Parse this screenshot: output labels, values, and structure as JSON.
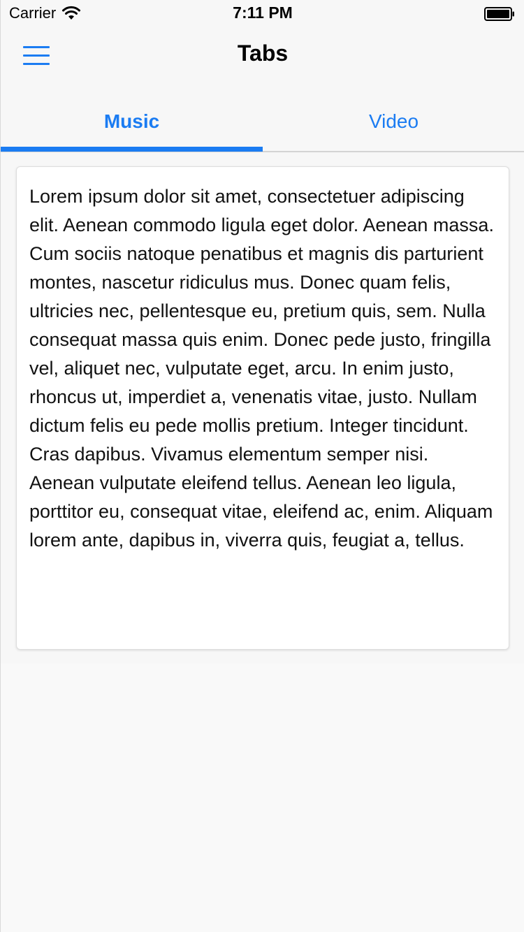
{
  "status_bar": {
    "carrier": "Carrier",
    "time": "7:11 PM"
  },
  "header": {
    "title": "Tabs",
    "menu_icon": "hamburger-menu-icon"
  },
  "tabs": [
    {
      "label": "Music",
      "active": true
    },
    {
      "label": "Video",
      "active": false
    }
  ],
  "card": {
    "text": "Lorem ipsum dolor sit amet, consectetuer adipiscing elit. Aenean commodo ligula eget dolor. Aenean massa. Cum sociis natoque penatibus et magnis dis parturient montes, nascetur ridiculus mus. Donec quam felis, ultricies nec, pellentesque eu, pretium quis, sem. Nulla consequat massa quis enim. Donec pede justo, fringilla vel, aliquet nec, vulputate eget, arcu. In enim justo, rhoncus ut, imperdiet a, venenatis vitae, justo. Nullam dictum felis eu pede mollis pretium. Integer tincidunt. Cras dapibus. Vivamus elementum semper nisi. Aenean vulputate eleifend tellus. Aenean leo ligula, porttitor eu, consequat vitae, eleifend ac, enim. Aliquam lorem ante, dapibus in, viverra quis, feugiat a, tellus."
  },
  "colors": {
    "accent": "#1b7cf2",
    "background": "#f7f7f7",
    "card": "#ffffff"
  }
}
